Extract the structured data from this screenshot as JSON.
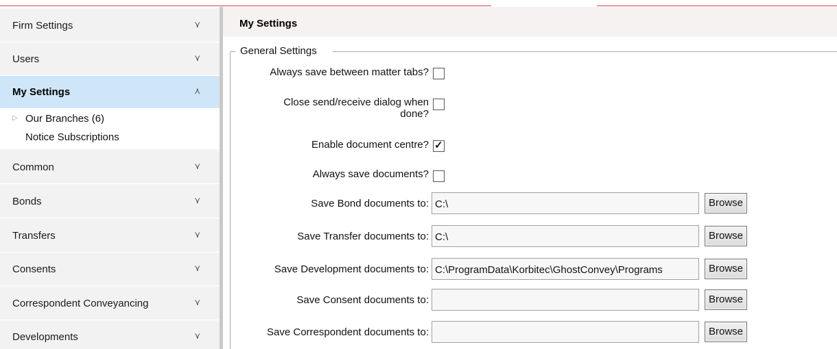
{
  "sidebar": {
    "sections": [
      {
        "label": "Firm Settings"
      },
      {
        "label": "Users"
      },
      {
        "label": "My Settings"
      },
      {
        "label": "Common"
      },
      {
        "label": "Bonds"
      },
      {
        "label": "Transfers"
      },
      {
        "label": "Consents"
      },
      {
        "label": "Correspondent Conveyancing"
      },
      {
        "label": "Developments"
      }
    ],
    "active_section": "My Settings",
    "sub_items": [
      {
        "label": "Our Branches (6)"
      },
      {
        "label": "Notice Subscriptions"
      }
    ],
    "icons": {
      "collapsed": "double-chevron-down-icon",
      "expanded": "double-chevron-up-icon",
      "tree": "expand-triangle-icon"
    }
  },
  "main": {
    "title": "My Settings",
    "group_label": "General Settings",
    "checkboxes": [
      {
        "label": "Always save between matter tabs?",
        "checked": false
      },
      {
        "label_line1": "Close send/receive dialog when",
        "label_line2": "done?",
        "checked": false
      },
      {
        "label": "Enable document centre?",
        "checked": true
      },
      {
        "label": "Always save documents?",
        "checked": false
      }
    ],
    "paths": [
      {
        "label": "Save Bond documents to:",
        "value": "C:\\",
        "button": "Browse"
      },
      {
        "label": "Save Transfer documents to:",
        "value": "C:\\",
        "button": "Browse"
      },
      {
        "label": "Save Development documents to:",
        "value": "C:\\ProgramData\\Korbitec\\GhostConvey\\Programs",
        "button": "Browse"
      },
      {
        "label": "Save Consent documents to:",
        "value": "",
        "button": "Browse"
      },
      {
        "label": "Save Correspondent documents to:",
        "value": "",
        "button": "Browse"
      }
    ]
  }
}
